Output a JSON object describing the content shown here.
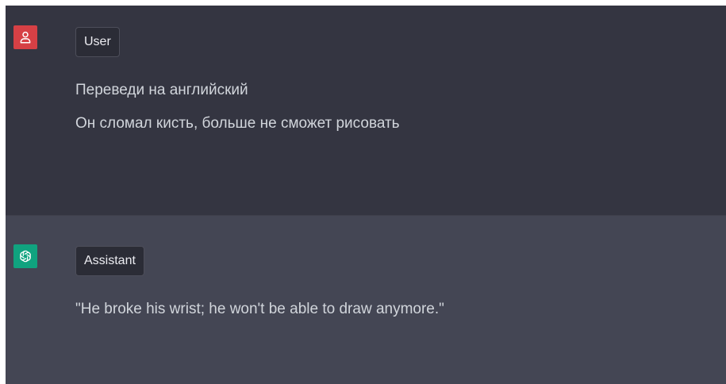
{
  "conversation": {
    "user": {
      "role_label": "User",
      "avatar_icon": "user-icon",
      "avatar_color": "#d64045",
      "lines": [
        "Переведи на английский",
        "Он сломал кисть, больше не сможет рисовать"
      ]
    },
    "assistant": {
      "role_label": "Assistant",
      "avatar_icon": "openai-logo-icon",
      "avatar_color": "#10a37f",
      "lines": [
        "\"He broke his wrist; he won't be able to draw anymore.\""
      ]
    }
  },
  "colors": {
    "user_bg": "#343541",
    "assistant_bg": "#444654",
    "text": "#d1d5db"
  }
}
